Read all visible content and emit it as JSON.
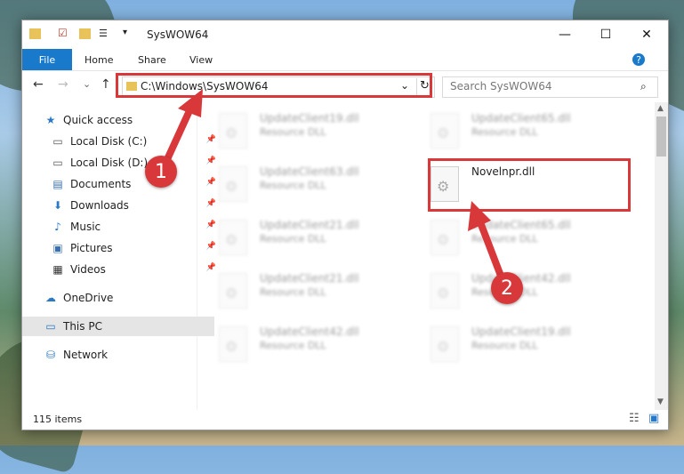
{
  "window": {
    "title": "SysWOW64",
    "minimize": "—",
    "maximize": "☐",
    "close": "✕"
  },
  "ribbon": {
    "file": "File",
    "tabs": [
      "Home",
      "Share",
      "View"
    ],
    "help": "?"
  },
  "nav": {
    "back": "←",
    "forward": "→",
    "recent": "⌄",
    "up": "↑"
  },
  "address": {
    "path": "C:\\Windows\\SysWOW64",
    "dropdown": "⌄",
    "refresh": "↻"
  },
  "search": {
    "placeholder": "Search SysWOW64"
  },
  "sidebar": [
    {
      "label": "Quick access",
      "icon": "star-icon",
      "glyph": "★",
      "color": "#2b78c5"
    },
    {
      "label": "Local Disk (C:)",
      "icon": "drive-icon",
      "glyph": "▭",
      "color": "#555"
    },
    {
      "label": "Local Disk (D:)",
      "icon": "drive-icon",
      "glyph": "▭",
      "color": "#555"
    },
    {
      "label": "Documents",
      "icon": "documents-icon",
      "glyph": "▤",
      "color": "#3a6fb0"
    },
    {
      "label": "Downloads",
      "icon": "download-icon",
      "glyph": "⬇",
      "color": "#2b78c5"
    },
    {
      "label": "Music",
      "icon": "music-icon",
      "glyph": "♪",
      "color": "#2b78c5"
    },
    {
      "label": "Pictures",
      "icon": "pictures-icon",
      "glyph": "▣",
      "color": "#3a6fb0"
    },
    {
      "label": "Videos",
      "icon": "videos-icon",
      "glyph": "▦",
      "color": "#333"
    },
    {
      "label": "OneDrive",
      "icon": "cloud-icon",
      "glyph": "☁",
      "color": "#2b78c5"
    },
    {
      "label": "This PC",
      "icon": "computer-icon",
      "glyph": "▭",
      "color": "#2b78c5"
    },
    {
      "label": "Network",
      "icon": "network-icon",
      "glyph": "⛁",
      "color": "#2b78c5"
    }
  ],
  "files_left": [
    {
      "name": "UpdateClient19.dll",
      "type": "Resource DLL"
    },
    {
      "name": "UpdateClient63.dll",
      "type": "Resource DLL"
    },
    {
      "name": "UpdateClient21.dll",
      "type": "Resource DLL"
    },
    {
      "name": "UpdateClient21.dll",
      "type": "Resource DLL"
    },
    {
      "name": "UpdateClient42.dll",
      "type": "Resource DLL"
    }
  ],
  "files_right": [
    {
      "name": "UpdateClient65.dll",
      "type": "Resource DLL"
    },
    {
      "name": "Novelnpr.dll",
      "type": ""
    },
    {
      "name": "UpdateClient65.dll",
      "type": "Resource DLL"
    },
    {
      "name": "UpdateClient42.dll",
      "type": "Resource DLL"
    },
    {
      "name": "UpdateClient19.dll",
      "type": "Resource DLL"
    }
  ],
  "status": {
    "count": "115 items"
  },
  "annotations": {
    "step1": "1",
    "step2": "2",
    "color": "#d9383a"
  }
}
